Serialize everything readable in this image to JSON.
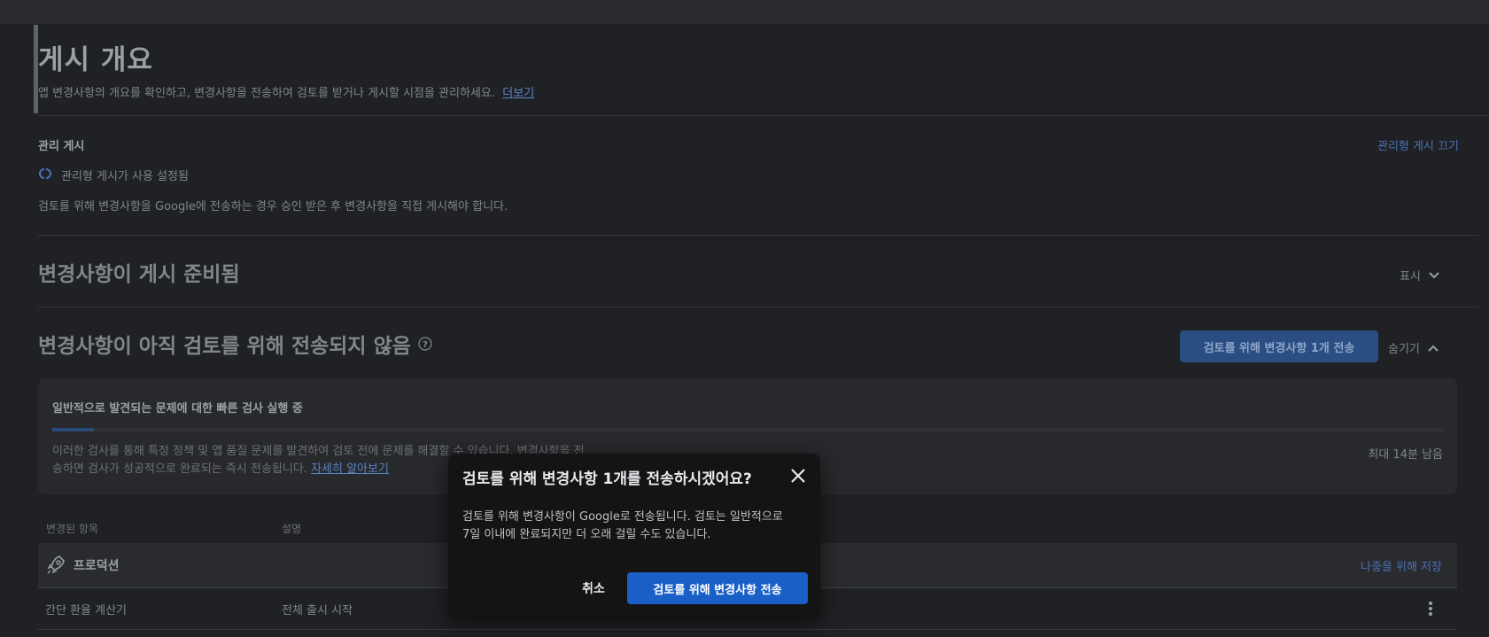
{
  "header": {
    "title": "게시 개요",
    "description": "앱 변경사항의 개요를 확인하고, 변경사항을 전송하여 검토를 받거나 게시할 시점을 관리하세요.",
    "more_link": "더보기"
  },
  "managed_publishing": {
    "label": "관리 게시",
    "turn_off_link": "관리형 게시 끄기",
    "status": "관리형 게시가 사용 설정됨",
    "note": "검토를 위해 변경사항을 Google에 전송하는 경우 승인 받은 후 변경사항을 직접 게시해야 합니다."
  },
  "ready_section": {
    "title": "변경사항이 게시 준비됨",
    "toggle_label": "표시"
  },
  "not_sent_section": {
    "title": "변경사항이 아직 검토를 위해 전송되지 않음",
    "send_button": "검토를 위해 변경사항 1개 전송",
    "toggle_label": "숨기기"
  },
  "quick_checks": {
    "title": "일반적으로 발견되는 문제에 대한 빠른 검사 실행 중",
    "progress": 0.03,
    "body_line1": "이러한 검사를 통해 특정 정책 및 앱 품질 문제를 발견하여 검토 전에 문제를 해결할 수 있습니다. 변경사항을 전",
    "body_line2": "송하면 검사가 성공적으로 완료되는 즉시 전송됩니다.",
    "learn_more": "자세히 알아보기",
    "time_left": "최대 14분 남음"
  },
  "table": {
    "col_changed": "변경된 항목",
    "col_description": "설명",
    "group_label": "프로덕션",
    "save_later": "나중을 위해 저장",
    "rows": [
      {
        "item": "간단 환율 계산기",
        "description": "전체 출시 시작"
      }
    ]
  },
  "dialog": {
    "title": "검토를 위해 변경사항 1개를 전송하시겠어요?",
    "body_line1": "검토를 위해 변경사항이 Google로 전송됩니다. 검토는 일반적으로",
    "body_line2": "7일 이내에 완료되지만 더 오래 걸릴 수도 있습니다.",
    "cancel": "취소",
    "confirm": "검토를 위해 변경사항 전송"
  },
  "colors": {
    "background": "#202124",
    "accent_blue": "#1a5fc6",
    "link_blue": "#4a72b8",
    "dialog_bg": "#141414"
  }
}
